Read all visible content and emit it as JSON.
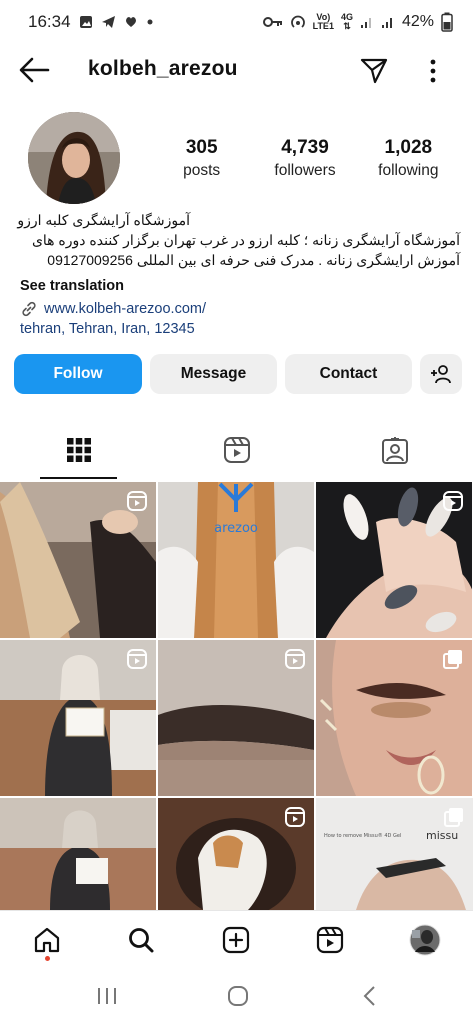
{
  "status_bar": {
    "time": "16:34",
    "network_top": "Vo)",
    "network_bottom": "LTE1",
    "net_gen": "4G",
    "battery": "42%"
  },
  "header": {
    "username": "kolbeh_arezou",
    "icons": [
      "back-arrow-icon",
      "direct-message-icon",
      "more-options-icon"
    ]
  },
  "stats": [
    {
      "value": "305",
      "label": "posts"
    },
    {
      "value": "4,739",
      "label": "followers"
    },
    {
      "value": "1,028",
      "label": "following"
    }
  ],
  "bio": {
    "name": "آموزشگاه آرایشگری کلبه ارزو",
    "line1": "آموزشگاه آرایشگری زنانه ؛ کلبه ارزو در غرب تهران برگزار کننده دوره های",
    "line2": "آموزش ارایشگری زنانه . مدرک فنی حرفه ای بین المللی 09127009256",
    "see_translation": "See translation",
    "link": "www.kolbeh-arezoo.com/",
    "location": "tehran, Tehran, Iran, 12345"
  },
  "actions": {
    "follow": "Follow",
    "message": "Message",
    "contact": "Contact"
  },
  "tabs": [
    "grid-tab",
    "reels-tab",
    "tagged-tab"
  ],
  "colors": {
    "follow_blue": "#1a96f0",
    "secondary_button": "#efefef",
    "link_blue": "#1b3f7a",
    "notification_dot": "#e4442f"
  },
  "bottom_nav": [
    "home-icon",
    "search-icon",
    "create-icon",
    "reels-icon",
    "profile-avatar"
  ]
}
